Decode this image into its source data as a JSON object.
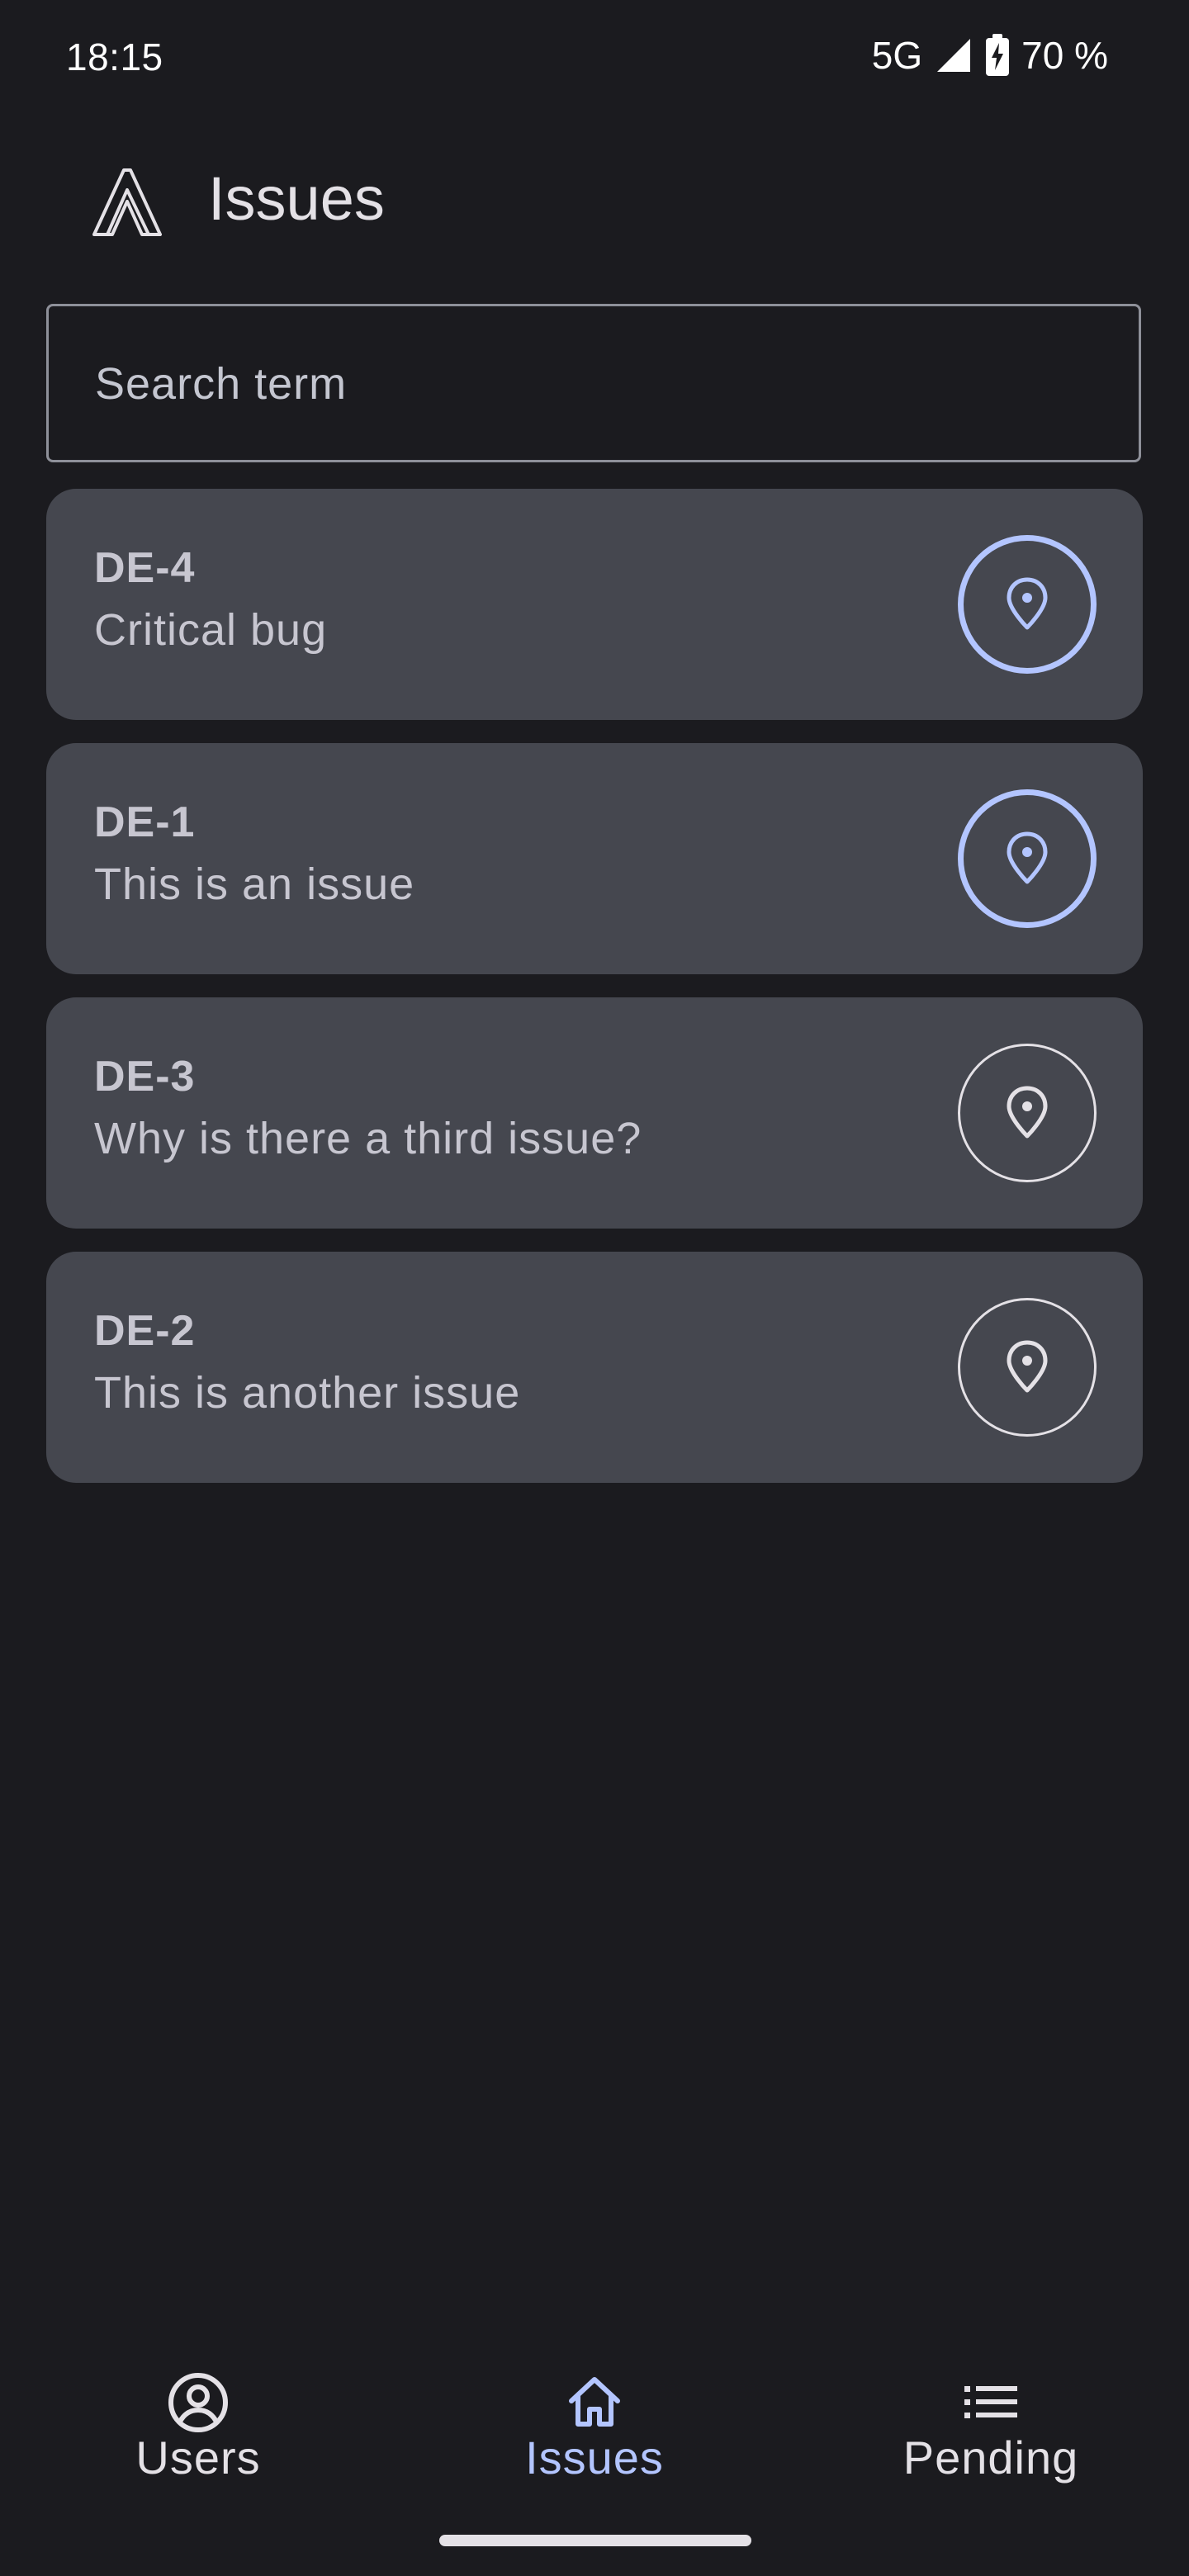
{
  "status_bar": {
    "time": "18:15",
    "network": "5G",
    "battery": "70 %"
  },
  "header": {
    "title": "Issues",
    "logo_icon": "app-logo-icon"
  },
  "search": {
    "placeholder": "Search term",
    "value": ""
  },
  "issues": [
    {
      "id": "DE-4",
      "title": "Critical bug",
      "location_active": true
    },
    {
      "id": "DE-1",
      "title": "This is an issue",
      "location_active": true
    },
    {
      "id": "DE-3",
      "title": "Why is there a third issue?",
      "location_active": false
    },
    {
      "id": "DE-2",
      "title": "This is another issue",
      "location_active": false
    }
  ],
  "bottom_nav": {
    "items": [
      {
        "label": "Users",
        "icon": "account-circle-icon",
        "selected": false
      },
      {
        "label": "Issues",
        "icon": "home-icon",
        "selected": true
      },
      {
        "label": "Pending",
        "icon": "list-icon",
        "selected": false
      }
    ]
  },
  "colors": {
    "background": "#1b1b1f",
    "card": "#45474f",
    "accent": "#b3c5ff",
    "text": "#e4e1e6",
    "muted_text": "#c7c6d0"
  }
}
